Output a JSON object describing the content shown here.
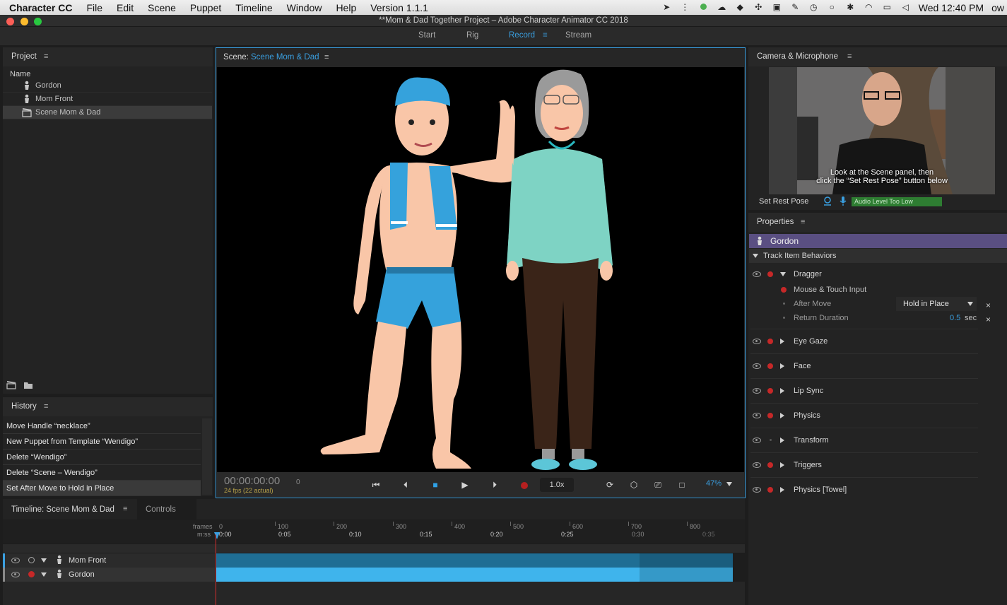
{
  "menubar": {
    "app_name": "Character CC",
    "items": [
      "File",
      "Edit",
      "Scene",
      "Puppet",
      "Timeline",
      "Window",
      "Help",
      "Version 1.1.1"
    ],
    "clock": "Wed 12:40 PM",
    "user": "ow"
  },
  "window": {
    "title": "**Mom & Dad Together Project – Adobe Character Animator CC 2018"
  },
  "workspace": {
    "modes": [
      "Start",
      "Rig",
      "Record",
      "Stream"
    ],
    "active_mode": "Record"
  },
  "project": {
    "title": "Project",
    "column_name": "Name",
    "items": [
      {
        "label": "Gordon",
        "icon": "puppet-icon"
      },
      {
        "label": "Mom Front",
        "icon": "puppet-icon"
      },
      {
        "label": "Scene Mom & Dad",
        "icon": "scene-icon",
        "selected": true
      }
    ]
  },
  "history": {
    "title": "History",
    "items": [
      "Move Handle “necklace”",
      "New Puppet from Template “Wendigo”",
      "Delete “Wendigo”",
      "Delete “Scene – Wendigo”",
      "Set After Move to Hold in Place"
    ],
    "selected_index": 4
  },
  "scene": {
    "title_prefix": "Scene:",
    "title_name": "Scene Mom & Dad",
    "timecode": "00:00:00:00",
    "frame": "0",
    "fps": "24 fps (22 actual)",
    "speed": "1.0x",
    "zoom": "47%"
  },
  "camera": {
    "title": "Camera & Microphone",
    "instruction_line1": "Look at the Scene panel, then",
    "instruction_line2": "click the “Set Rest Pose” button below",
    "set_rest_pose_label": "Set Rest Pose",
    "audio_level": "Audio Level Too Low"
  },
  "properties": {
    "title": "Properties",
    "puppet_name": "Gordon",
    "section": "Track Item Behaviors",
    "dragger": {
      "name": "Dragger",
      "mouse_touch": "Mouse & Touch Input",
      "after_move_label": "After Move",
      "after_move_value": "Hold in Place",
      "return_duration_label": "Return Duration",
      "return_duration_value": "0.5",
      "return_duration_unit": "sec"
    },
    "behaviors": [
      "Eye Gaze",
      "Face",
      "Lip Sync",
      "Physics",
      "Transform",
      "Triggers",
      "Physics [Towel]"
    ]
  },
  "timeline": {
    "title": "Timeline: Scene Mom & Dad",
    "controls_tab": "Controls",
    "frames_label": "frames",
    "mss_label": "m:ss",
    "frame_ticks": [
      "0",
      "100",
      "200",
      "300",
      "400",
      "500",
      "600",
      "700",
      "800"
    ],
    "time_ticks": [
      "0:00",
      "0:05",
      "0:10",
      "0:15",
      "0:20",
      "0:25",
      "0:30",
      "0:35"
    ],
    "tracks": [
      "Mom Front",
      "Gordon"
    ]
  },
  "colors": {
    "accent_blue": "#3a9fe0",
    "record_red": "#c62828",
    "puppet_header_purple": "#5a4f82",
    "audio_green": "#2e7d32",
    "track_mom": "#1f6e94",
    "track_gordon": "#3fb4ec"
  }
}
